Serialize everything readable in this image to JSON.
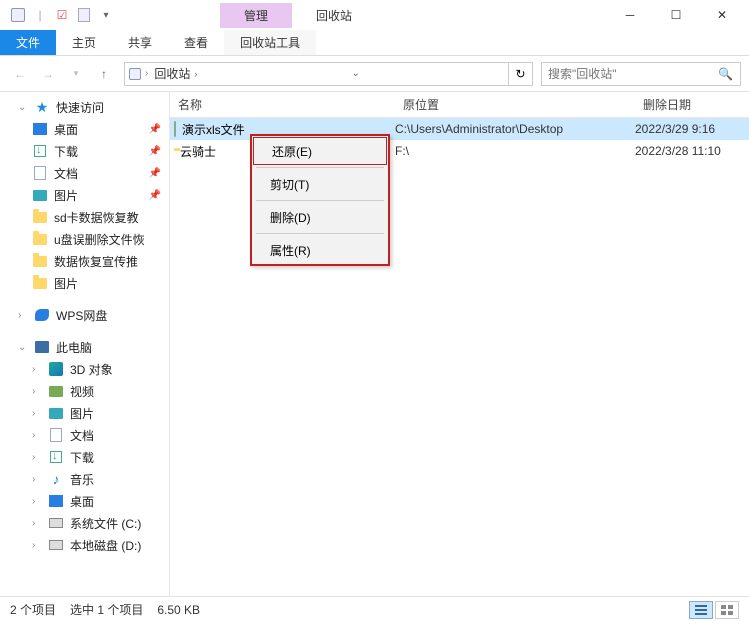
{
  "titlebar": {
    "manage_tab": "管理",
    "window_title": "回收站"
  },
  "ribbon": {
    "file": "文件",
    "home": "主页",
    "share": "共享",
    "view": "查看",
    "recycle_tools": "回收站工具"
  },
  "nav": {
    "breadcrumb": "回收站",
    "search_placeholder": "搜索\"回收站\""
  },
  "columns": {
    "name": "名称",
    "location": "原位置",
    "date_deleted": "删除日期"
  },
  "files": [
    {
      "name": "演示xls文件",
      "location": "C:\\Users\\Administrator\\Desktop",
      "date": "2022/3/29 9:16",
      "icon": "doc",
      "selected": true
    },
    {
      "name": "云骑士",
      "location": "F:\\",
      "date": "2022/3/28 11:10",
      "icon": "folder",
      "selected": false
    }
  ],
  "context_menu": {
    "restore": "还原(E)",
    "cut": "剪切(T)",
    "delete": "删除(D)",
    "properties": "属性(R)"
  },
  "sidebar": {
    "quick_access": "快速访问",
    "desktop": "桌面",
    "downloads": "下载",
    "documents": "文档",
    "pictures": "图片",
    "sd_recovery": "sd卡数据恢复教",
    "usb_recovery": "u盘误删除文件恢",
    "data_recovery_promo": "数据恢复宣传推",
    "pictures2": "图片",
    "wps": "WPS网盘",
    "this_pc": "此电脑",
    "objects_3d": "3D 对象",
    "videos": "视频",
    "pictures3": "图片",
    "documents2": "文档",
    "downloads2": "下载",
    "music": "音乐",
    "desktop2": "桌面",
    "system_c": "系统文件 (C:)",
    "local_d": "本地磁盘 (D:)"
  },
  "statusbar": {
    "item_count": "2 个项目",
    "selection": "选中 1 个项目",
    "size": "6.50 KB"
  }
}
